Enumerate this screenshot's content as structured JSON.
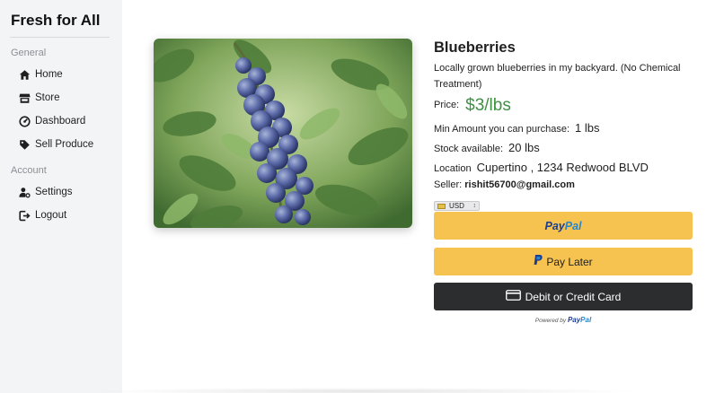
{
  "app": {
    "title": "Fresh for All"
  },
  "sidebar": {
    "sections": [
      {
        "label": "General"
      },
      {
        "label": "Account"
      }
    ],
    "items": [
      {
        "label": "Home",
        "icon": "home-icon"
      },
      {
        "label": "Store",
        "icon": "store-icon"
      },
      {
        "label": "Dashboard",
        "icon": "dashboard-icon"
      },
      {
        "label": "Sell Produce",
        "icon": "tag-icon"
      },
      {
        "label": "Settings",
        "icon": "user-gear-icon"
      },
      {
        "label": "Logout",
        "icon": "logout-icon"
      }
    ]
  },
  "product": {
    "name": "Blueberries",
    "description": "Locally grown blueberries in my backyard. (No Chemical Treatment)",
    "price_label": "Price:",
    "price_value": "$3/lbs",
    "min_label": "Min Amount you can purchase:",
    "min_value": "1 lbs",
    "stock_label": "Stock available:",
    "stock_value": "20 lbs",
    "location_label": "Location",
    "location_value": "Cupertino , 1234 Redwood BLVD",
    "seller_label": "Seller:",
    "seller_value": "rishit56700@gmail.com"
  },
  "payment": {
    "currency": "USD",
    "paypal_pay": "Pay",
    "paypal_pal": "Pal",
    "pay_later_label": "Pay Later",
    "card_label": "Debit or Credit Card",
    "powered_by": "Powered by"
  },
  "colors": {
    "price": "#3f9142",
    "paypal_button": "#f6c350",
    "card_button": "#2b2d2f",
    "sidebar_bg": "#f3f4f6"
  }
}
